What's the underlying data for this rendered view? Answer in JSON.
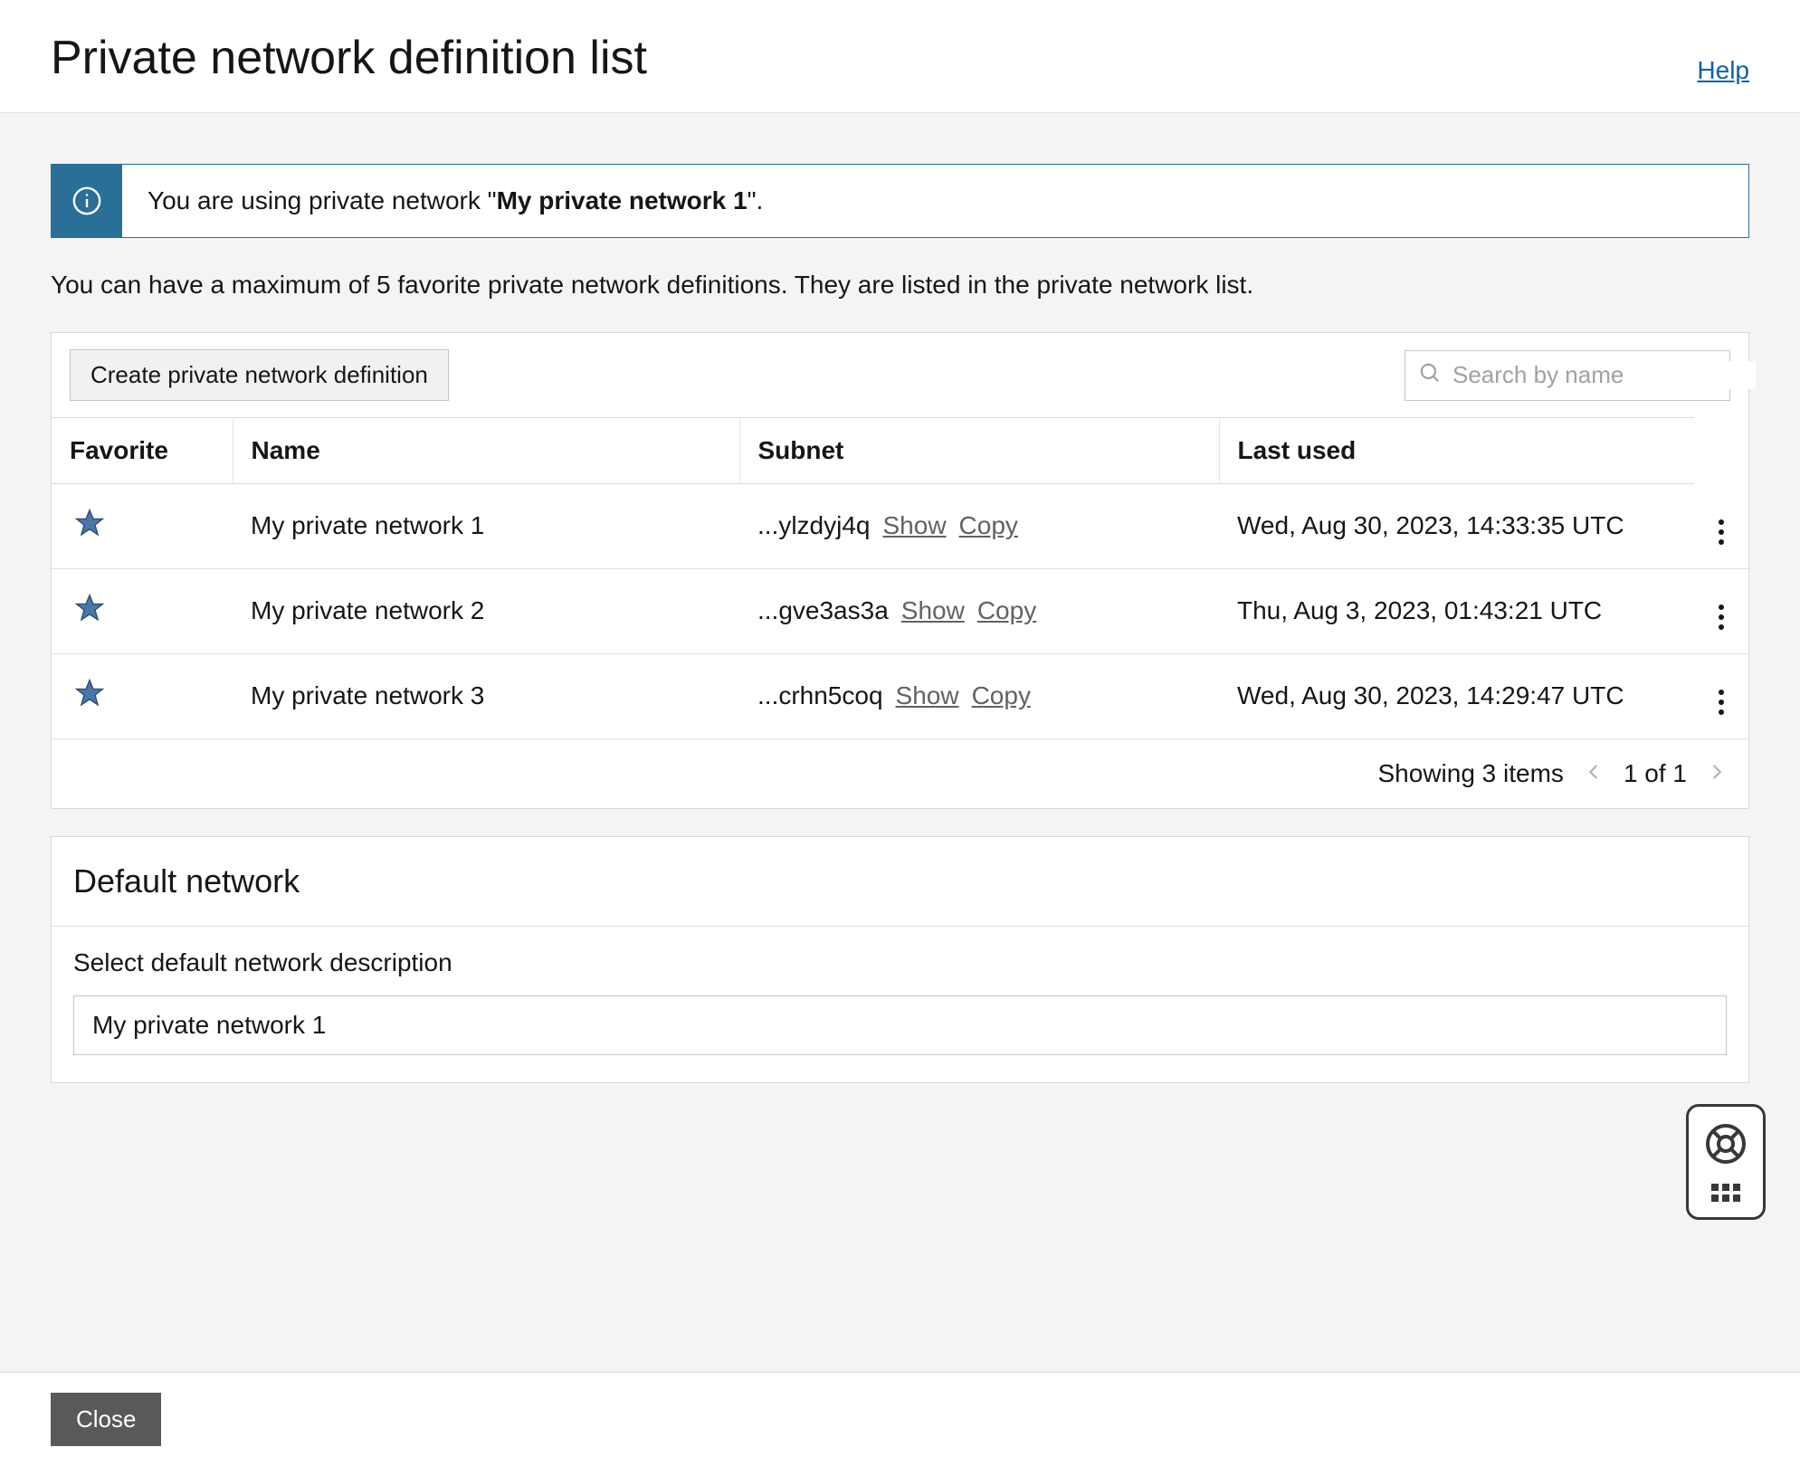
{
  "header": {
    "title": "Private network definition list",
    "help_label": "Help"
  },
  "banner": {
    "prefix": "You are using private network \"",
    "network": "My private network 1",
    "suffix": "\"."
  },
  "description": "You can have a maximum of 5 favorite private network definitions. They are listed in the private network list.",
  "toolbar": {
    "create_label": "Create private network definition",
    "search_placeholder": "Search by name"
  },
  "columns": {
    "favorite": "Favorite",
    "name": "Name",
    "subnet": "Subnet",
    "last_used": "Last used"
  },
  "actions": {
    "show": "Show",
    "copy": "Copy"
  },
  "rows": [
    {
      "name": "My private network 1",
      "subnet_snippet": "...ylzdyj4q",
      "last_used": "Wed, Aug 30, 2023, 14:33:35 UTC"
    },
    {
      "name": "My private network 2",
      "subnet_snippet": "...gve3as3a",
      "last_used": "Thu, Aug 3, 2023, 01:43:21 UTC"
    },
    {
      "name": "My private network 3",
      "subnet_snippet": "...crhn5coq",
      "last_used": "Wed, Aug 30, 2023, 14:29:47 UTC"
    }
  ],
  "paging": {
    "showing": "Showing 3 items",
    "page_of": "1 of 1"
  },
  "default_network": {
    "title": "Default network",
    "label": "Select default network description",
    "selected": "My private network 1"
  },
  "footer": {
    "close": "Close"
  }
}
